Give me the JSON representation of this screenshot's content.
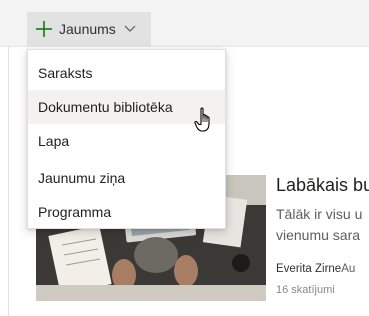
{
  "toolbar": {
    "new_label": "Jaunums",
    "icons": {
      "plus": "plus-icon",
      "chevron": "chevron-down-icon"
    },
    "accent_color": "#107c10"
  },
  "new_menu": {
    "items": [
      {
        "label": "Saraksts"
      },
      {
        "label": "Dokumentu bibliotēka"
      },
      {
        "label": "Lapa"
      },
      {
        "label": "Jaunumu ziņa"
      },
      {
        "label": "Programma"
      }
    ],
    "hovered_item": "Dokumentu bibliotēka"
  },
  "news_card": {
    "title": "Labākais bu",
    "description_line1": "Tālāk ir visu u",
    "description_line2": "vienumu sara",
    "author": "Everita Zirne",
    "author_suffix": "Au",
    "views": "16 skatījumi"
  },
  "cursor": {
    "icon": "hand-pointer-icon"
  }
}
